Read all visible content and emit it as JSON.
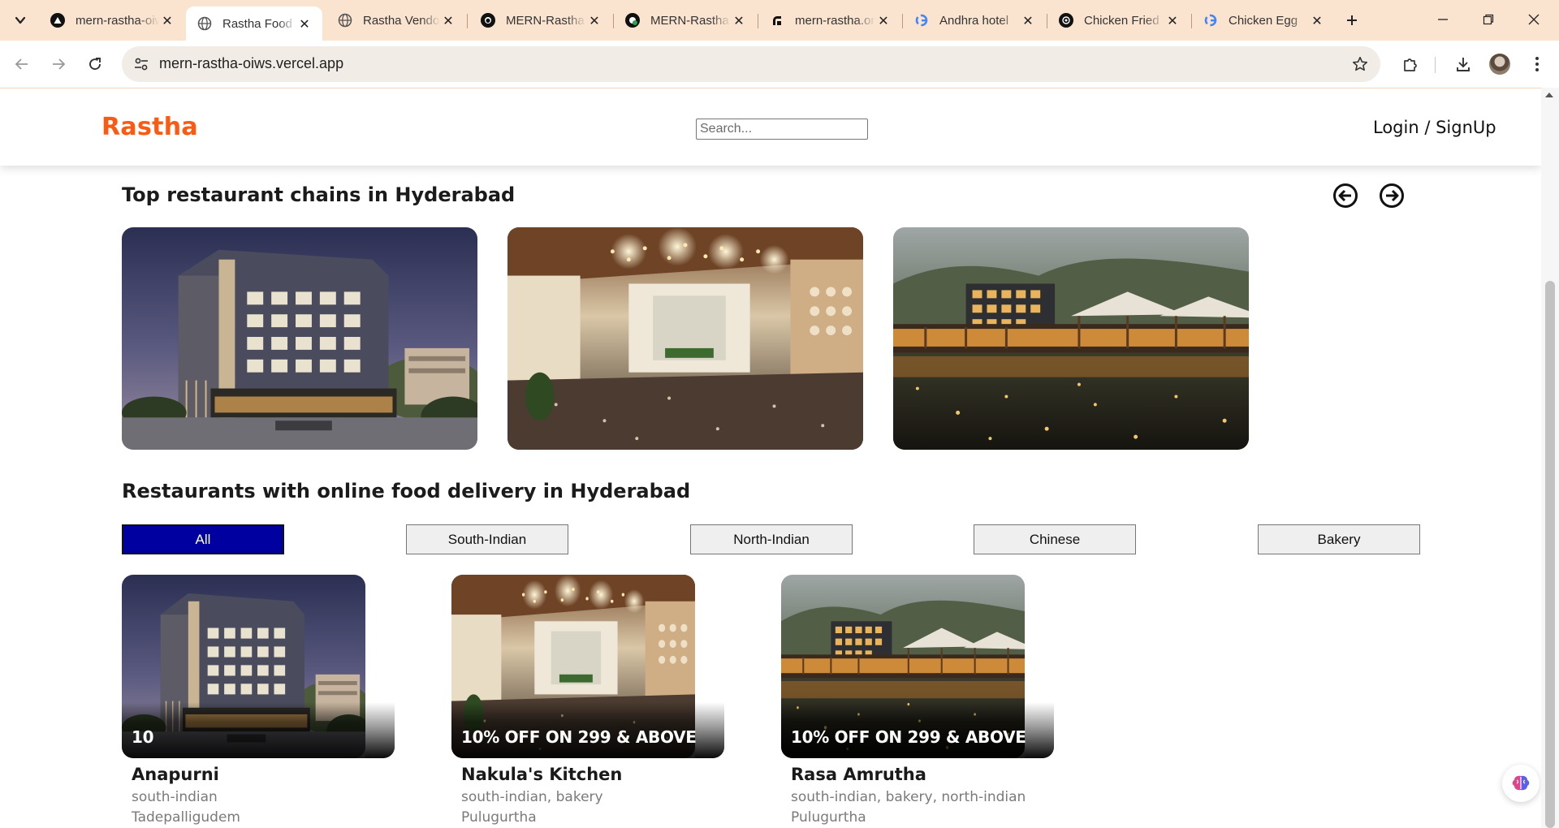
{
  "browser": {
    "tabs": [
      {
        "title": "mern-rastha-oiws",
        "icon": "vercel-icon",
        "active": false
      },
      {
        "title": "Rastha Food",
        "icon": "globe-icon",
        "active": true
      },
      {
        "title": "Rastha Vendor",
        "icon": "globe-icon",
        "active": false
      },
      {
        "title": "MERN-Rastha",
        "icon": "github-icon",
        "active": false
      },
      {
        "title": "MERN-Rastha",
        "icon": "github-deploy-icon",
        "active": false
      },
      {
        "title": "mern-rastha.onrender",
        "icon": "render-icon",
        "active": false
      },
      {
        "title": "Andhra hotel",
        "icon": "google-icon",
        "active": false
      },
      {
        "title": "Chicken Fried",
        "icon": "chatgpt-icon",
        "active": false
      },
      {
        "title": "Chicken Egg",
        "icon": "google-icon",
        "active": false
      }
    ],
    "url": "mern-rastha-oiws.vercel.app"
  },
  "header": {
    "logo": "Rastha",
    "search_placeholder": "Search...",
    "login": "Login / SignUp"
  },
  "chains": {
    "title": "Top restaurant chains in Hyderabad",
    "images": [
      "hotel-building",
      "hotel-lobby",
      "resort-pool"
    ]
  },
  "delivery": {
    "title": "Restaurants with online food delivery in Hyderabad",
    "filters": [
      "All",
      "South-Indian",
      "North-Indian",
      "Chinese",
      "Bakery"
    ],
    "active_filter": "All",
    "restaurants": [
      {
        "offer": "10",
        "name": "Anapurni",
        "cuisines": "south-indian",
        "location": "Tadepalligudem",
        "image": "hotel-building"
      },
      {
        "offer": "10% OFF ON 299 & ABOVE",
        "name": "Nakula's Kitchen",
        "cuisines": "south-indian, bakery",
        "location": "Pulugurtha",
        "image": "hotel-lobby"
      },
      {
        "offer": "10% OFF ON 299 & ABOVE",
        "name": "Rasa Amrutha",
        "cuisines": "south-indian, bakery, north-indian",
        "location": "Pulugurtha",
        "image": "resort-pool"
      }
    ]
  },
  "colors": {
    "brand": "#fc5a13",
    "active_filter_bg": "#0000a0",
    "tabstrip_bg": "#fbe4cf"
  }
}
